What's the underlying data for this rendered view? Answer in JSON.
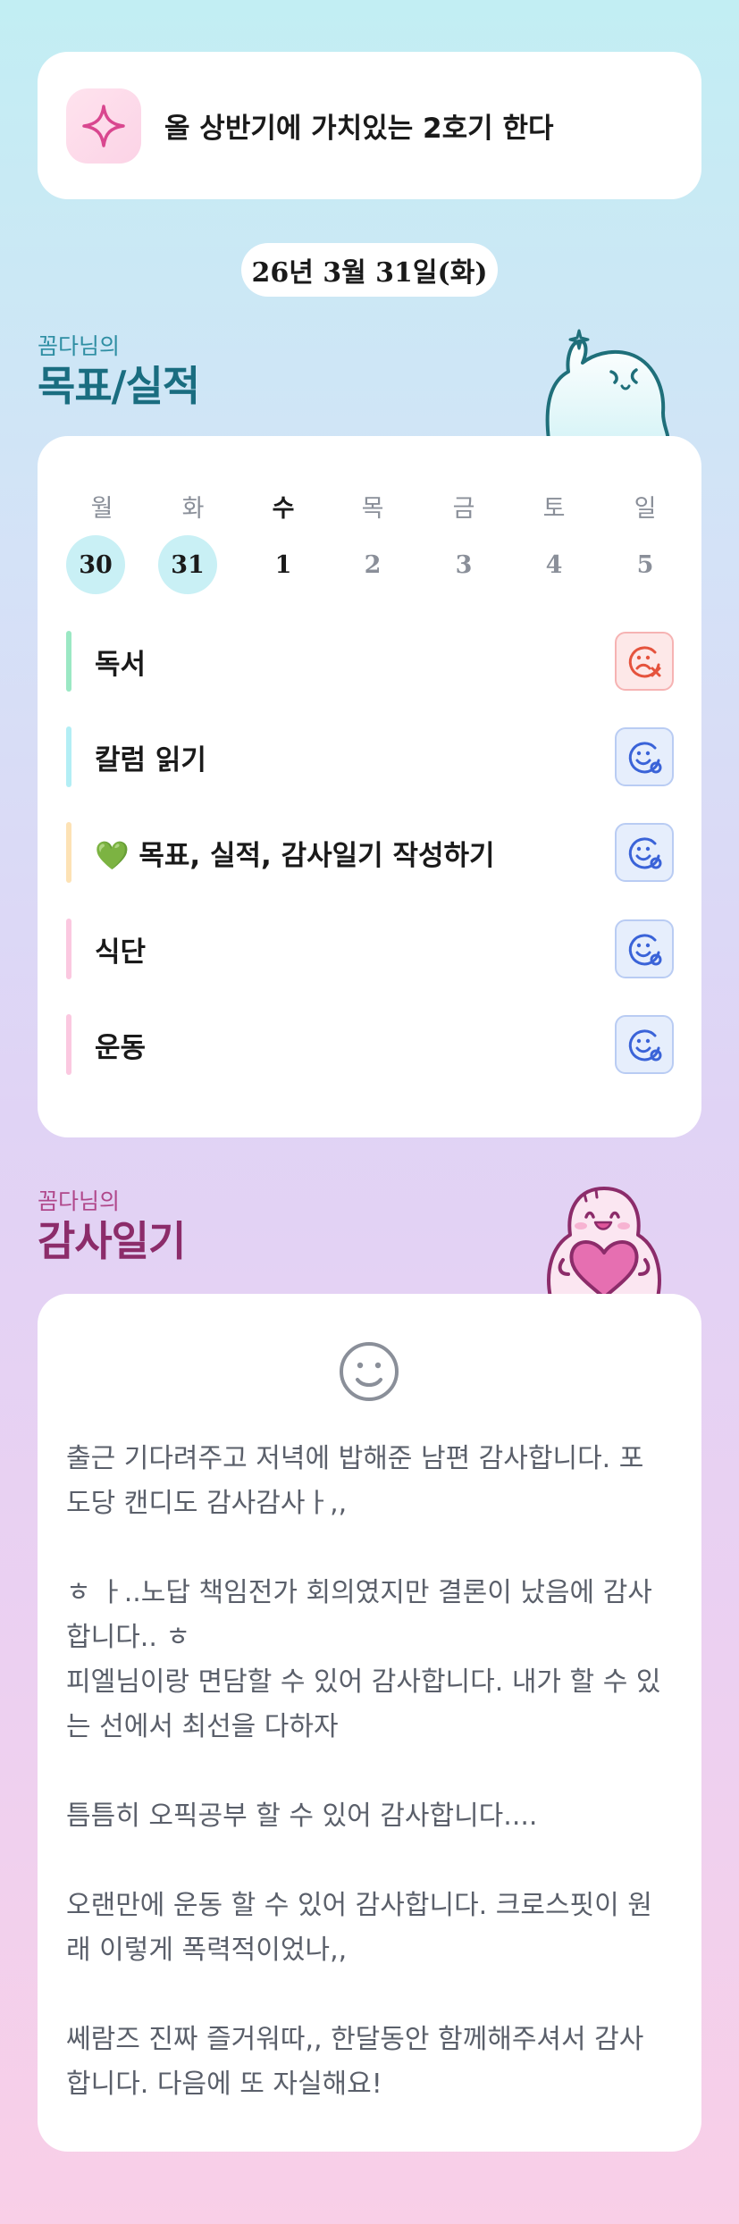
{
  "motto": {
    "icon": "sparkle-icon",
    "text": "올 상반기에 가치있는 2호기 한다"
  },
  "date_label": "26년 3월 31일(화)",
  "goals": {
    "owner_label": "꼼다님의",
    "title": "목표/실적",
    "mascot": "waving-ghost-mascot",
    "week": {
      "weekdays": [
        "월",
        "화",
        "수",
        "목",
        "금",
        "토",
        "일"
      ],
      "dates": [
        "30",
        "31",
        "1",
        "2",
        "3",
        "4",
        "5"
      ],
      "highlighted": [
        "30",
        "31"
      ],
      "today": "1"
    },
    "items": [
      {
        "label": "독서",
        "bar_color": "#9be8c4",
        "status": "failed",
        "status_icon": "sad-face-x-icon"
      },
      {
        "label": "칼럼 읽기",
        "bar_color": "#b3eef5",
        "status": "done",
        "status_icon": "smile-check-icon"
      },
      {
        "label": "💚 목표, 실적, 감사일기 작성하기",
        "bar_color": "#fde2b5",
        "status": "done",
        "status_icon": "smile-check-icon"
      },
      {
        "label": "식단",
        "bar_color": "#fbc8e0",
        "status": "done",
        "status_icon": "smile-check-icon"
      },
      {
        "label": "운동",
        "bar_color": "#fbc8e0",
        "status": "done",
        "status_icon": "smile-check-icon"
      }
    ]
  },
  "gratitude": {
    "owner_label": "꼼다님의",
    "title": "감사일기",
    "mascot": "heart-hugging-mascot",
    "mood_icon": "smile-face-icon",
    "lines": [
      "출근 기다려주고 저녁에 밥해준 남편 감사합니다. 포",
      "도당 캔디도 감사감사ㅏ,,",
      "",
      "ㅎ ㅏ..노답 책임전가 회의였지만 결론이 났음에 감사",
      "합니다.. ㅎ",
      "피엘님이랑 면담할 수 있어 감사합니다. 내가 할 수 있",
      "는 선에서 최선을 다하자",
      "",
      "틈틈히 오픽공부 할 수 있어 감사합니다....",
      "",
      "오랜만에 운동 할 수 있어 감사합니다. 크로스핏이 원",
      "래 이렇게 폭력적이었나,,",
      "",
      "쎄람즈 진짜 즐거워따,, 한달동안 함께해주셔서 감사",
      "합니다. 다음에 또 자실해요!"
    ]
  }
}
